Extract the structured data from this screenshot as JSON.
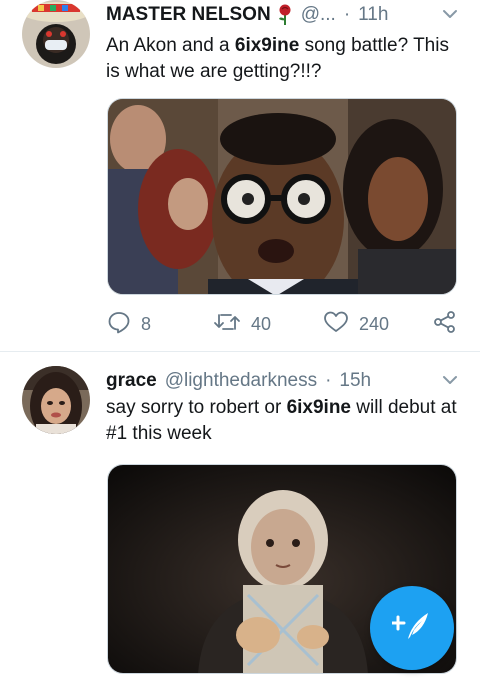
{
  "tweets": [
    {
      "name": "MASTER NELSON",
      "handle": "@...",
      "dot": "·",
      "time": "11h",
      "text_parts": [
        "An Akon and a ",
        "6ix9ine",
        " song battle? This is what we are getting?!!?"
      ],
      "stats": {
        "replies": "8",
        "retweets": "40",
        "likes": "240"
      }
    },
    {
      "name": "grace",
      "handle": "@lighthedarkness",
      "dot": "·",
      "time": "15h",
      "text_parts": [
        "say sorry to robert or ",
        "6ix9ine",
        " will debut at #1 this week"
      ]
    }
  ],
  "icons": {
    "reply": "reply-icon",
    "retweet": "retweet-icon",
    "like": "heart-icon",
    "share": "share-icon",
    "more": "chevron-down-icon",
    "compose": "compose-tweet-icon"
  },
  "colors": {
    "accent": "#1da1f2",
    "secondary_text": "#657786",
    "rose": "#c0202a"
  }
}
